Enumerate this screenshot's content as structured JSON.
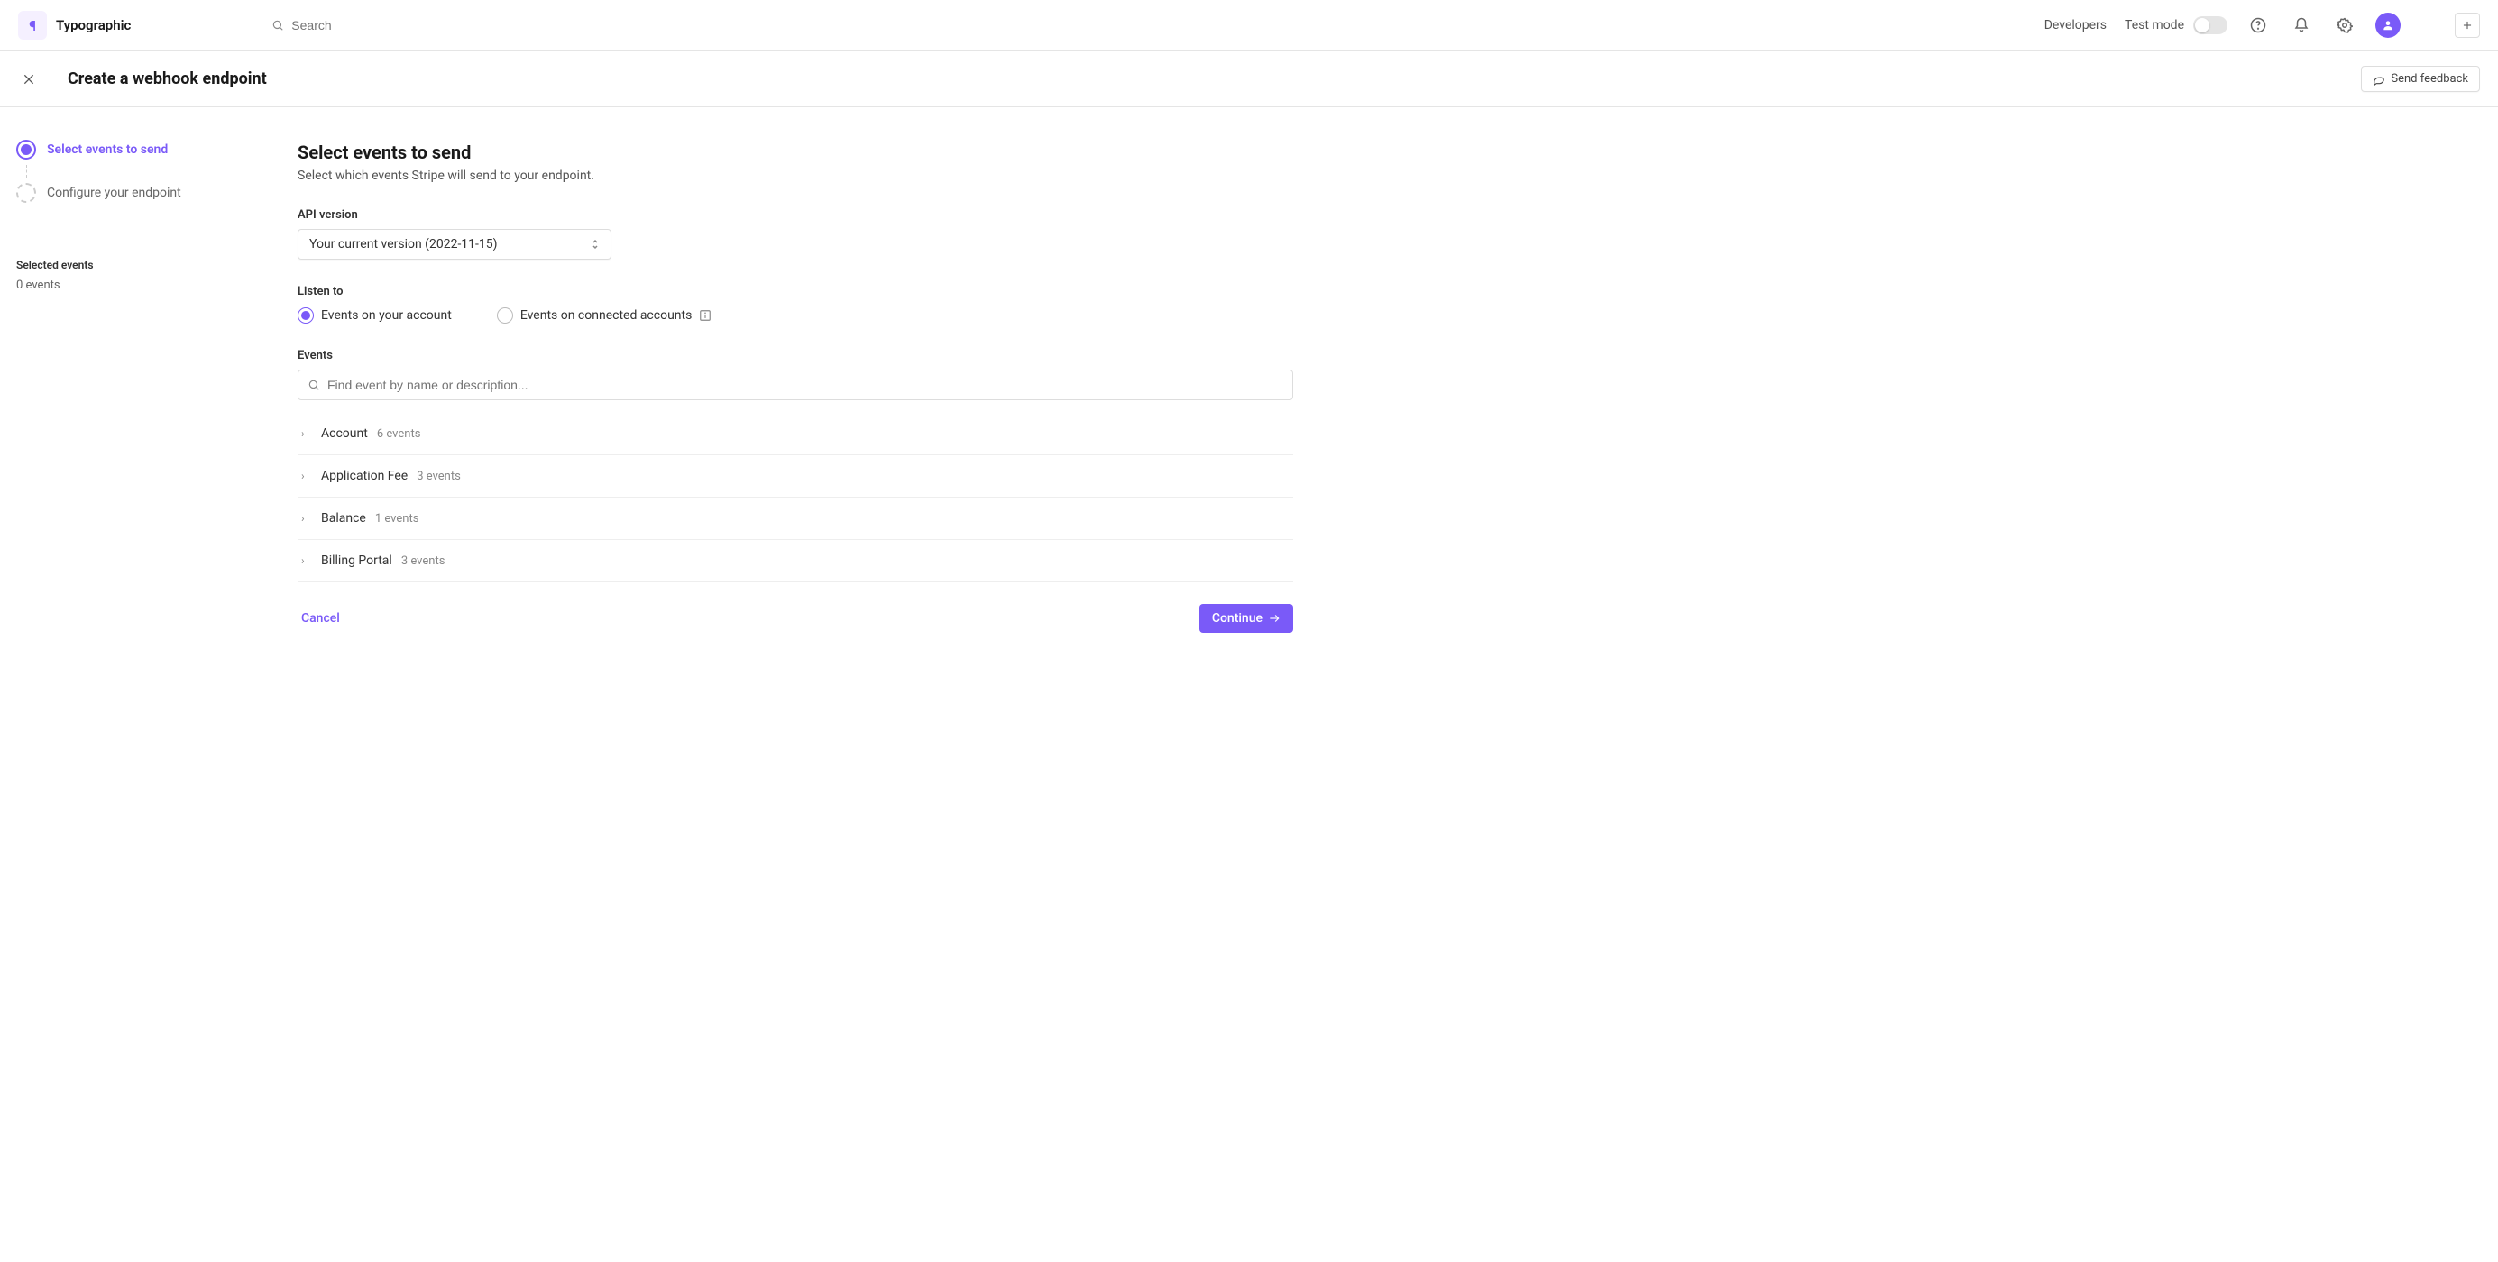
{
  "header": {
    "brand": "Typographic",
    "search_placeholder": "Search",
    "developers": "Developers",
    "test_mode": "Test mode"
  },
  "subheader": {
    "title": "Create a webhook endpoint",
    "feedback": "Send feedback"
  },
  "sidebar": {
    "steps": [
      {
        "label": "Select events to send",
        "active": true
      },
      {
        "label": "Configure your endpoint",
        "active": false
      }
    ],
    "selected_label": "Selected events",
    "selected_count": "0 events"
  },
  "content": {
    "title": "Select events to send",
    "subtitle": "Select which events Stripe will send to your endpoint.",
    "api_version_label": "API version",
    "api_version_value": "Your current version (2022-11-15)",
    "listen_to_label": "Listen to",
    "radio_account": "Events on your account",
    "radio_connected": "Events on connected accounts",
    "events_label": "Events",
    "events_search_placeholder": "Find event by name or description...",
    "event_groups": [
      {
        "name": "Account",
        "count": "6 events"
      },
      {
        "name": "Application Fee",
        "count": "3 events"
      },
      {
        "name": "Balance",
        "count": "1 events"
      },
      {
        "name": "Billing Portal",
        "count": "3 events"
      }
    ],
    "cancel": "Cancel",
    "continue": "Continue"
  }
}
